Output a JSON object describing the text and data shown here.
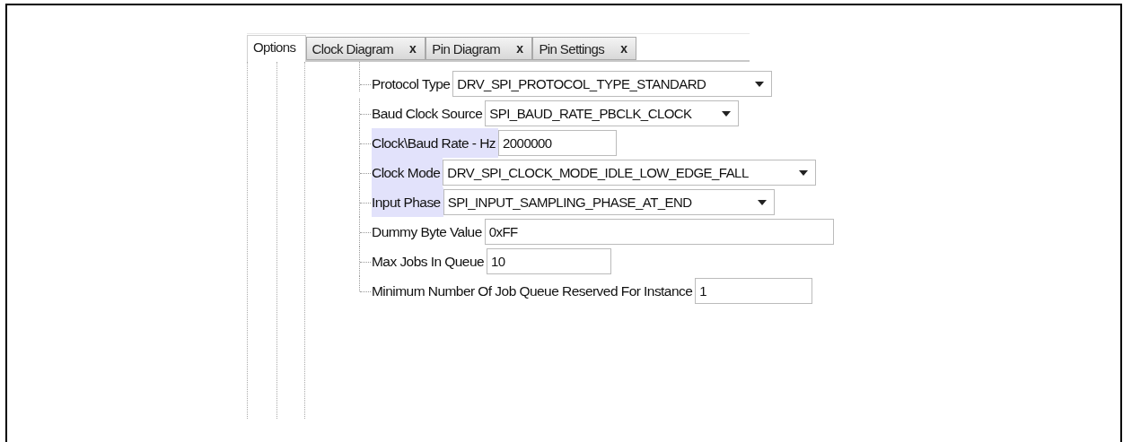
{
  "tabs": [
    {
      "label": "Options",
      "selected": true
    },
    {
      "label": "Clock Diagram",
      "selected": false,
      "close": "x"
    },
    {
      "label": "Pin Diagram",
      "selected": false,
      "close": "x"
    },
    {
      "label": "Pin Settings",
      "selected": false,
      "close": "x"
    }
  ],
  "settings": [
    {
      "label": "Protocol Type",
      "kind": "dropdown",
      "value": "DRV_SPI_PROTOCOL_TYPE_STANDARD",
      "highlighted": false
    },
    {
      "label": "Baud Clock Source",
      "kind": "dropdown",
      "value": "SPI_BAUD_RATE_PBCLK_CLOCK",
      "highlighted": false
    },
    {
      "label": "Clock\\Baud Rate - Hz",
      "kind": "text",
      "value": "2000000",
      "highlighted": true
    },
    {
      "label": "Clock Mode",
      "kind": "dropdown",
      "value": "DRV_SPI_CLOCK_MODE_IDLE_LOW_EDGE_FALL",
      "highlighted": true
    },
    {
      "label": "Input Phase",
      "kind": "dropdown",
      "value": "SPI_INPUT_SAMPLING_PHASE_AT_END",
      "highlighted": true
    },
    {
      "label": "Dummy Byte Value",
      "kind": "text",
      "value": "0xFF",
      "highlighted": false
    },
    {
      "label": "Max Jobs In Queue",
      "kind": "text",
      "value": "10",
      "highlighted": false
    },
    {
      "label": "Minimum Number Of Job Queue Reserved For Instance",
      "kind": "text",
      "value": "1",
      "highlighted": false
    }
  ]
}
